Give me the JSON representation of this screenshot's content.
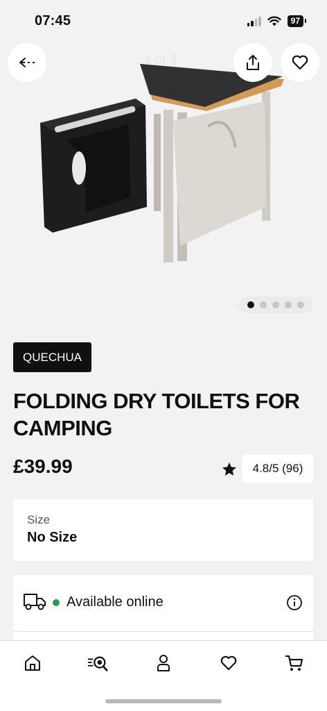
{
  "status": {
    "time": "07:45",
    "battery": "97"
  },
  "gallery": {
    "counter": "1 of 3",
    "dot_count": 5,
    "active_dot": 0
  },
  "product": {
    "brand": "QUECHUA",
    "title": "FOLDING DRY TOILETS FOR CAMPING",
    "price": "£39.99",
    "rating": "4.8/5 (96)"
  },
  "size": {
    "label": "Size",
    "value": "No Size"
  },
  "availability": {
    "text": "Available online"
  },
  "icons": {
    "back": "back-arrow-icon",
    "share": "share-icon",
    "favorite": "heart-icon",
    "rating": "star-icon",
    "delivery": "truck-icon",
    "info": "info-icon",
    "tabs": [
      "home-icon",
      "search-icon",
      "account-icon",
      "heart-icon",
      "cart-icon"
    ]
  },
  "colors": {
    "available": "#1e9f55",
    "brand_bg": "#101010"
  }
}
